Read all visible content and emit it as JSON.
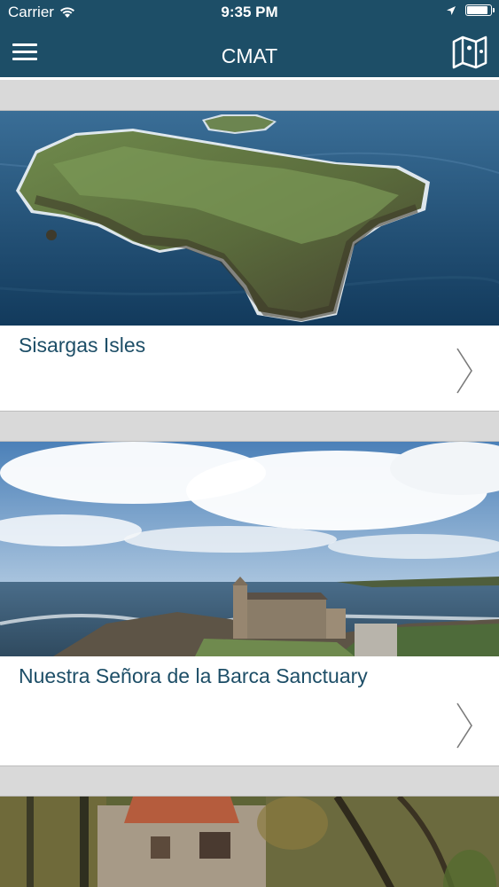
{
  "status_bar": {
    "carrier": "Carrier",
    "time": "9:35 PM",
    "battery_level": 0.9
  },
  "nav": {
    "title": "CMAT",
    "menu_icon": "hamburger-menu-icon",
    "map_icon": "map-icon",
    "bar_color": "#1d4e67",
    "title_color": "#ffffff"
  },
  "list": {
    "accent_color": "#1d4e67",
    "items": [
      {
        "title": "Sisargas Isles",
        "image": "island-aerial-photo"
      },
      {
        "title": "Nuestra Señora de la Barca Sanctuary",
        "image": "coastal-sanctuary-photo"
      },
      {
        "title": "",
        "image": "stone-house-forest-photo"
      }
    ]
  }
}
